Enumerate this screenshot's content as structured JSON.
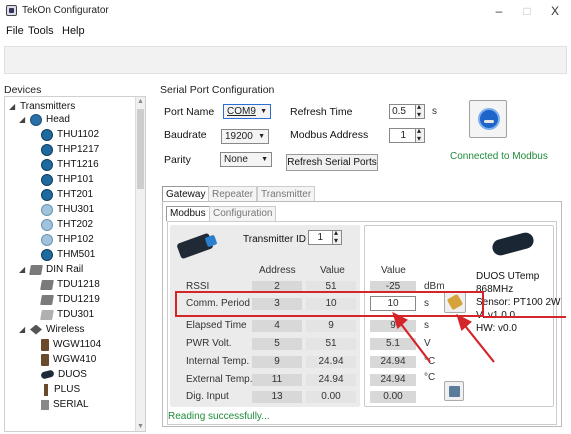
{
  "window": {
    "title": "TekOn Configurator",
    "minimize": "–",
    "maximize": "□",
    "close": "X"
  },
  "menu": [
    "File",
    "Tools",
    "Help"
  ],
  "devices_label": "Devices",
  "tree": [
    {
      "label": "Transmitters",
      "expand": "◢"
    },
    {
      "label": "Head",
      "expand": "◢"
    },
    {
      "label": "THU1102"
    },
    {
      "label": "THP1217"
    },
    {
      "label": "THT1216"
    },
    {
      "label": "THP101"
    },
    {
      "label": "THT201"
    },
    {
      "label": "THU301"
    },
    {
      "label": "THT202"
    },
    {
      "label": "THP102"
    },
    {
      "label": "THM501"
    },
    {
      "label": "DIN Rail",
      "expand": "◢"
    },
    {
      "label": "TDU1218"
    },
    {
      "label": "TDU1219"
    },
    {
      "label": "TDU301"
    },
    {
      "label": "Wireless",
      "expand": "◢"
    },
    {
      "label": "WGW1104"
    },
    {
      "label": "WGW410"
    },
    {
      "label": "DUOS"
    },
    {
      "label": "PLUS"
    },
    {
      "label": "SERIAL"
    }
  ],
  "serial": {
    "section_label": "Serial Port Configuration",
    "port_name_label": "Port Name",
    "port_name_value": "COM9",
    "baudrate_label": "Baudrate",
    "baudrate_value": "19200",
    "parity_label": "Parity",
    "parity_value": "None",
    "refresh_time_label": "Refresh Time",
    "refresh_time_value": "0.5",
    "refresh_time_unit": "s",
    "modbus_address_label": "Modbus Address",
    "modbus_address_value": "1",
    "refresh_ports_button": "Refresh Serial Ports",
    "connection_status": "Connected to Modbus"
  },
  "tabs": [
    "Gateway",
    "Repeater",
    "Transmitter"
  ],
  "subtabs": [
    "Modbus",
    "Configuration"
  ],
  "table": {
    "transmitter_id_label": "Transmitter ID",
    "transmitter_id_value": "1",
    "col_address": "Address",
    "col_value": "Value",
    "col_value2": "Value",
    "rows": [
      {
        "label": "RSSI",
        "address": "2",
        "value": "51",
        "value2": "-25",
        "unit": "dBm"
      },
      {
        "label": "Comm. Period",
        "address": "3",
        "value": "10",
        "value2": "10",
        "unit": "s"
      },
      {
        "label": "Elapsed Time",
        "address": "4",
        "value": "9",
        "value2": "9",
        "unit": "s"
      },
      {
        "label": "PWR Volt.",
        "address": "5",
        "value": "51",
        "value2": "5.1",
        "unit": "V"
      },
      {
        "label": "Internal Temp.",
        "address": "9",
        "value": "24.94",
        "value2": "24.94",
        "unit": "°C"
      },
      {
        "label": "External Temp.",
        "address": "11",
        "value": "24.94",
        "value2": "24.94",
        "unit": "°C"
      },
      {
        "label": "Dig. Input",
        "address": "13",
        "value": "0.00",
        "value2": "0.00",
        "unit": ""
      }
    ]
  },
  "duos_info": [
    "DUOS UTemp",
    "868MHz",
    "Sensor: PT100 2W",
    "V: v1.0.0",
    "HW: v0.0"
  ],
  "status": "Reading successfully...",
  "colors": {
    "highlight": "#d4252a",
    "status_green": "#1e8c3a"
  }
}
